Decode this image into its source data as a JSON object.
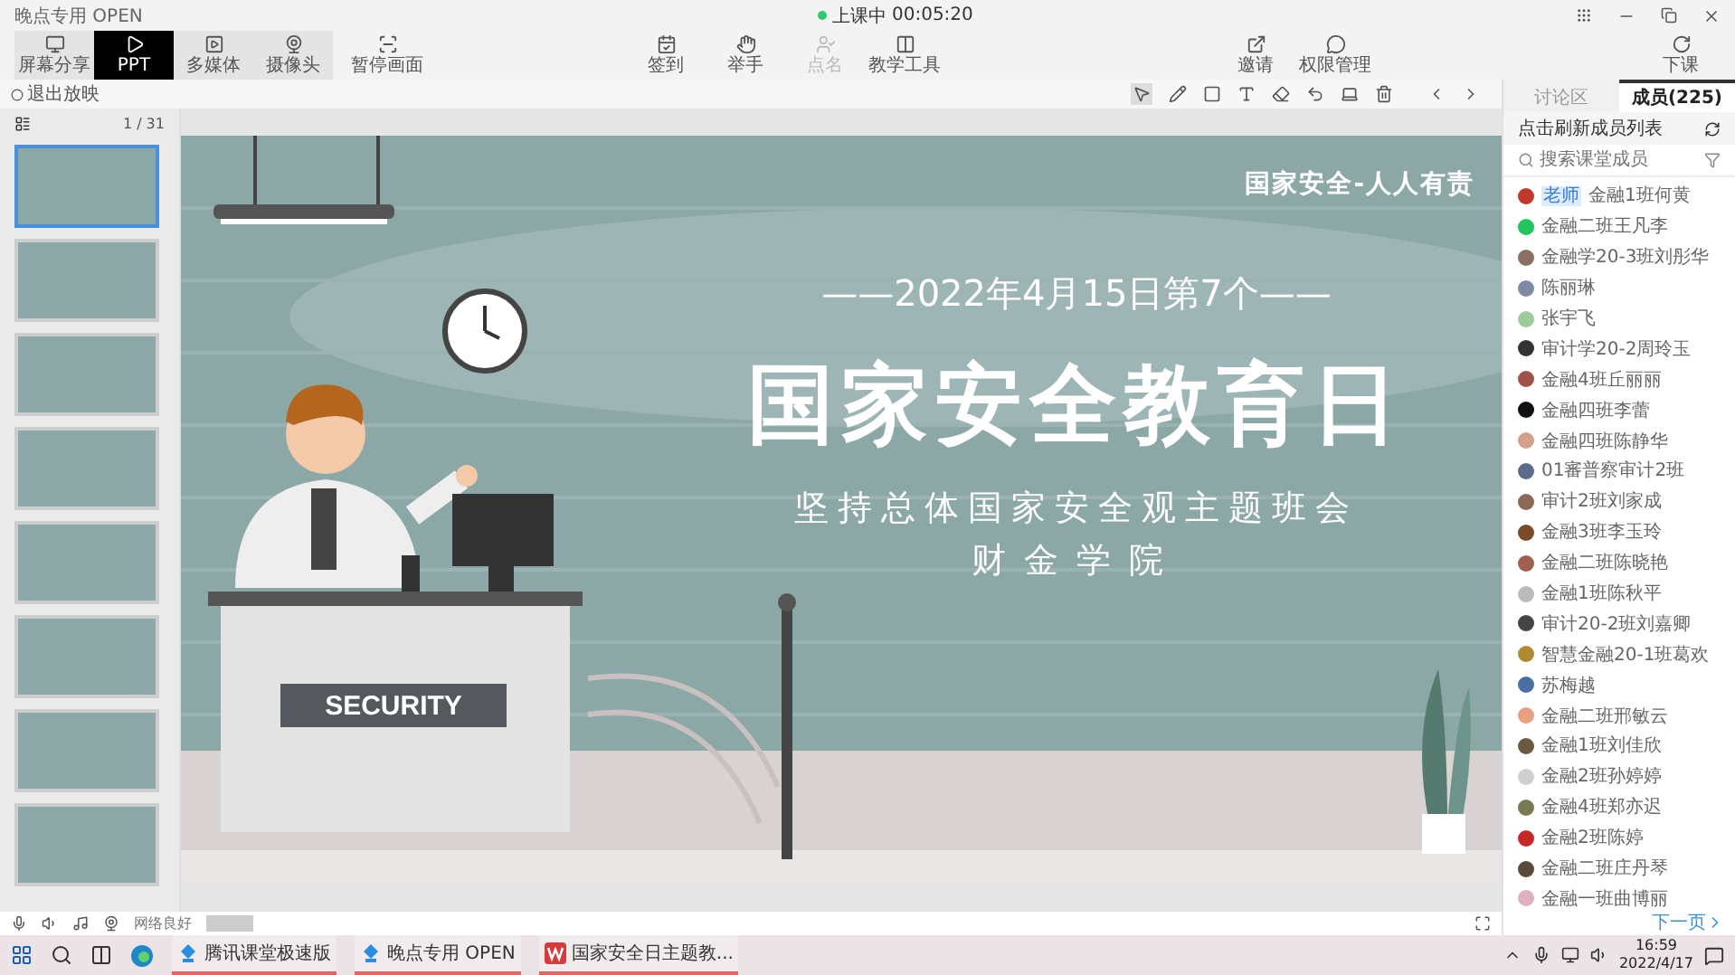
{
  "window": {
    "title": "晚点专用 OPEN",
    "status": "上课中",
    "timer": "00:05:20"
  },
  "toolbar_left": [
    {
      "label": "屏幕分享",
      "selected": false
    },
    {
      "label": "PPT",
      "selected": true
    },
    {
      "label": "多媒体",
      "selected": false
    },
    {
      "label": "摄像头",
      "selected": false
    }
  ],
  "pause_button": {
    "label": "暂停画面"
  },
  "toolbar_center": [
    {
      "label": "签到",
      "disabled": false
    },
    {
      "label": "举手",
      "disabled": false
    },
    {
      "label": "点名",
      "disabled": true
    },
    {
      "label": "教学工具",
      "disabled": false
    }
  ],
  "toolbar_right": [
    {
      "label": "邀请"
    },
    {
      "label": "权限管理"
    }
  ],
  "end_class": {
    "label": "下课"
  },
  "exit_show": "退出放映",
  "slides_panel": {
    "counter": "1 / 31",
    "thumbnails": [
      {
        "selected": true
      },
      {
        "selected": false
      },
      {
        "selected": false
      },
      {
        "selected": false
      },
      {
        "selected": false
      },
      {
        "selected": false
      },
      {
        "selected": false
      },
      {
        "selected": false
      }
    ]
  },
  "slide": {
    "tagline": "国家安全-人人有责",
    "date_line": "——2022年4月15日第7个——",
    "title": "国家安全教育日",
    "subtitle": "坚持总体国家安全观主题班会",
    "org": "财金学院",
    "desk_sign": "SECURITY"
  },
  "side_panel": {
    "tabs": [
      {
        "label": "讨论区",
        "selected": false
      },
      {
        "label": "成员(225)",
        "selected": true
      }
    ],
    "refresh_label": "点击刷新成员列表",
    "search_placeholder": "搜索课堂成员",
    "members": [
      {
        "name": "金融1班何黄",
        "badge": "老师",
        "color": "#c0392b"
      },
      {
        "name": "金融二班王凡李",
        "color": "#22c55e"
      },
      {
        "name": "金融学20-3班刘彤华",
        "color": "#8d6e63"
      },
      {
        "name": "陈丽琳",
        "color": "#7e8aa2"
      },
      {
        "name": "张宇飞",
        "color": "#9ccc9c"
      },
      {
        "name": "审计学20-2周玲玉",
        "color": "#333333"
      },
      {
        "name": "金融4班丘丽丽",
        "color": "#a0524a"
      },
      {
        "name": "金融四班李蕾",
        "color": "#111111"
      },
      {
        "name": "金融四班陈静华",
        "color": "#d4a08a"
      },
      {
        "name": "01審普察审计2班",
        "color": "#5d6b8a"
      },
      {
        "name": "审计2班刘家成",
        "color": "#8a6a55"
      },
      {
        "name": "金融3班李玉玲",
        "color": "#7a4a2a"
      },
      {
        "name": "金融二班陈晓艳",
        "color": "#a06050"
      },
      {
        "name": "金融1班陈秋平",
        "color": "#bbbbbb"
      },
      {
        "name": "审计20-2班刘嘉卿",
        "color": "#444444"
      },
      {
        "name": "智慧金融20-1班葛欢",
        "color": "#b08a30"
      },
      {
        "name": "苏梅越",
        "color": "#4a6fa5"
      },
      {
        "name": "金融二班邢敏云",
        "color": "#e8a080"
      },
      {
        "name": "金融1班刘佳欣",
        "color": "#6a5a40"
      },
      {
        "name": "金融2班孙婷婷",
        "color": "#cfcfcf"
      },
      {
        "name": "金融4班郑亦迟",
        "color": "#7a7a50"
      },
      {
        "name": "金融2班陈婷",
        "color": "#c62828"
      },
      {
        "name": "金融二班庄丹琴",
        "color": "#5a4a3a"
      },
      {
        "name": "金融一班曲博丽",
        "color": "#e0b0c0"
      }
    ],
    "next_page": "下一页"
  },
  "status_bar": {
    "network": "网络良好"
  },
  "taskbar": {
    "apps": [
      {
        "label": "腾讯课堂极速版",
        "kind": "classroom"
      },
      {
        "label": "晚点专用 OPEN",
        "kind": "classroom"
      },
      {
        "label": "国家安全日主题教...",
        "kind": "document"
      }
    ],
    "time": "16:59",
    "date": "2022/4/17"
  }
}
